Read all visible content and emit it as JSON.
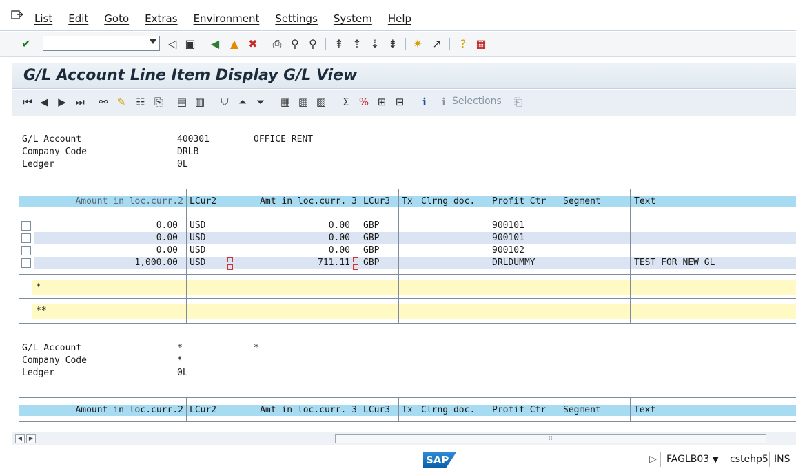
{
  "menu": {
    "items": [
      "List",
      "Edit",
      "Goto",
      "Extras",
      "Environment",
      "Settings",
      "System",
      "Help"
    ]
  },
  "title": "G/L Account Line Item Display G/L View",
  "app_toolbar": {
    "selections_label": "Selections"
  },
  "header1": {
    "labels": [
      "G/L Account",
      "Company Code",
      "Ledger"
    ],
    "values": [
      "400301",
      "DRLB",
      "0L"
    ],
    "account_text": "OFFICE RENT"
  },
  "columns": [
    "Amount in loc.curr.2",
    "LCur2",
    "Amt in loc.curr. 3",
    "LCur3",
    "Tx",
    "Clrng doc.",
    "Profit Ctr",
    "Segment",
    "Text"
  ],
  "rows": [
    {
      "amount2": "0.00",
      "lcur2": "USD",
      "amount3": "0.00",
      "lcur3": "GBP",
      "tx": "",
      "clrng": "",
      "profit_ctr": "900101",
      "segment": "",
      "text": ""
    },
    {
      "amount2": "0.00",
      "lcur2": "USD",
      "amount3": "0.00",
      "lcur3": "GBP",
      "tx": "",
      "clrng": "",
      "profit_ctr": "900101",
      "segment": "",
      "text": ""
    },
    {
      "amount2": "0.00",
      "lcur2": "USD",
      "amount3": "0.00",
      "lcur3": "GBP",
      "tx": "",
      "clrng": "",
      "profit_ctr": "900102",
      "segment": "",
      "text": ""
    },
    {
      "amount2": "1,000.00",
      "lcur2": "USD",
      "amount3": "711.11",
      "lcur3": "GBP",
      "tx": "",
      "clrng": "",
      "profit_ctr": "DRLDUMMY",
      "segment": "",
      "text": "TEST FOR NEW GL"
    }
  ],
  "totals": {
    "single": "*",
    "double": "**"
  },
  "header2": {
    "labels": [
      "G/L Account",
      "Company Code",
      "Ledger"
    ],
    "values": [
      "*",
      "*",
      "0L"
    ],
    "account_text": "*"
  },
  "status": {
    "transaction": "FAGLB03",
    "server": "cstehp5",
    "mode": "INS",
    "logo": "SAP"
  }
}
